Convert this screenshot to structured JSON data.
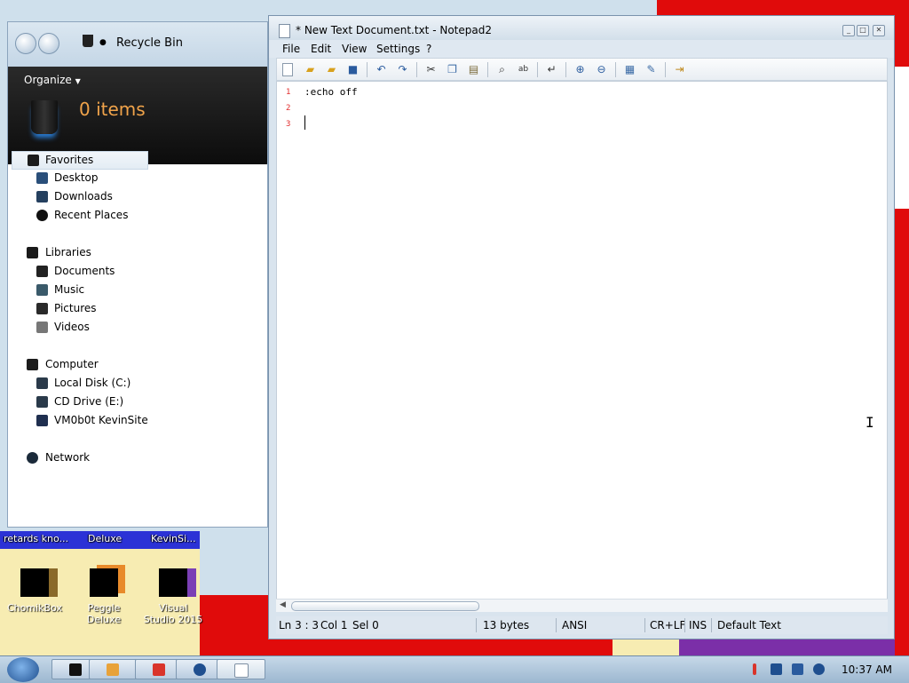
{
  "explorer": {
    "breadcrumb": "Recycle Bin",
    "organize_label": "Organize",
    "items_count": "0 items",
    "nav": {
      "favorites": "Favorites",
      "desktop": "Desktop",
      "downloads": "Downloads",
      "recent_places": "Recent Places",
      "libraries": "Libraries",
      "documents": "Documents",
      "music": "Music",
      "pictures": "Pictures",
      "videos": "Videos",
      "computer": "Computer",
      "local_disk": "Local Disk (C:)",
      "cd_drive": "CD Drive (E:)",
      "kevinsite": "VM0b0t KevinSite",
      "network": "Network"
    }
  },
  "notepad": {
    "title": "* New Text Document.txt - Notepad2",
    "menu": [
      "File",
      "Edit",
      "View",
      "Settings",
      "?"
    ],
    "lines": [
      {
        "num": "1",
        "text": ":echo off"
      },
      {
        "num": "2",
        "text": ""
      },
      {
        "num": "3",
        "text": ""
      }
    ],
    "status": {
      "position": "Ln 3 : 3",
      "col": "Col 1",
      "sel": "Sel 0",
      "size": "13 bytes",
      "encoding": "ANSI",
      "line_endings": "CR+LF",
      "mode": "INS",
      "scheme": "Default Text"
    }
  },
  "desktop": {
    "top_labels": [
      "retards kno...",
      "Deluxe",
      "KevinSi..."
    ],
    "icons": [
      {
        "label": "ChomikBox"
      },
      {
        "label": "Peggle Deluxe"
      },
      {
        "label": "Visual Studio 2015"
      }
    ]
  },
  "taskbar": {
    "clock": "10:37 AM"
  },
  "colors": {
    "line_number": "#e22d2d",
    "items_count": "#f0a34a",
    "wallpaper_red": "#e00b0b"
  }
}
